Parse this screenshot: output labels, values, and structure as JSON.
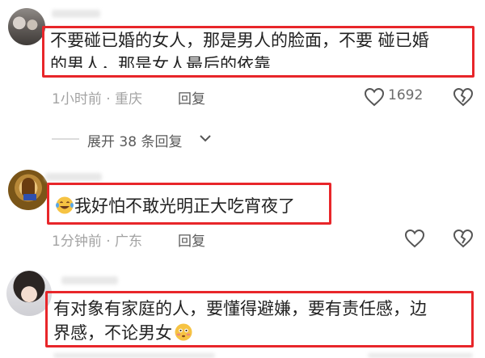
{
  "comments": [
    {
      "text_line1": "不要碰已婚的女人，那是男人的脸面，不要 碰已婚",
      "text_line2": "的男人，那是女人最后的依靠",
      "time": "1小时前",
      "location": "重庆",
      "reply_label": "回复",
      "likes": "1692"
    },
    {
      "text": "我好怕不敢光明正大吃宵夜了",
      "time": "1分钟前",
      "location": "广东",
      "reply_label": "回复"
    },
    {
      "text_line1": "有对象有家庭的人，要懂得避嫌，要有责任感，边",
      "text_line2": "界感，不论男女"
    }
  ],
  "expand_replies": {
    "label": "展开 38 条回复"
  },
  "icons": {
    "like": "heart-outline-icon",
    "dislike": "broken-heart-icon",
    "expand": "chevron-down-icon",
    "emoji_laugh": "laughing-tears-emoji",
    "emoji_blush": "blushing-emoji"
  },
  "colors": {
    "highlight": "#e8262a",
    "meta": "#a3a3a3"
  }
}
